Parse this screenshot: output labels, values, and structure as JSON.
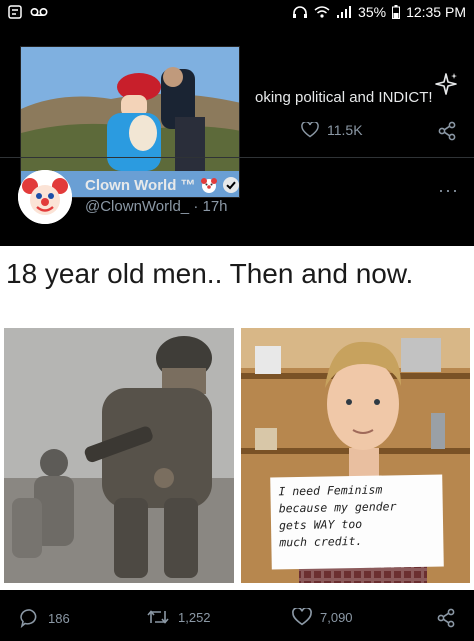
{
  "status_bar": {
    "battery": "35%",
    "time": "12:35 PM"
  },
  "previous_tweet": {
    "text": "oking political and INDICT!",
    "likes": "11.5K"
  },
  "tweet": {
    "author_name": "Clown World ™",
    "handle": "@ClownWorld_",
    "separator": "·",
    "time_ago": "17h",
    "more": "···",
    "meme": {
      "caption": "18 year old men.. Then and now.",
      "sign_lines": [
        "I need Feminism",
        "because my gender",
        "gets WAY too",
        "much credit."
      ]
    },
    "actions": {
      "replies": "186",
      "retweets": "1,252",
      "likes": "7,090"
    }
  },
  "colors": {
    "background": "#000000",
    "text": "#e7e9ea",
    "muted": "#8b98a5",
    "verified": "#ffffff"
  }
}
